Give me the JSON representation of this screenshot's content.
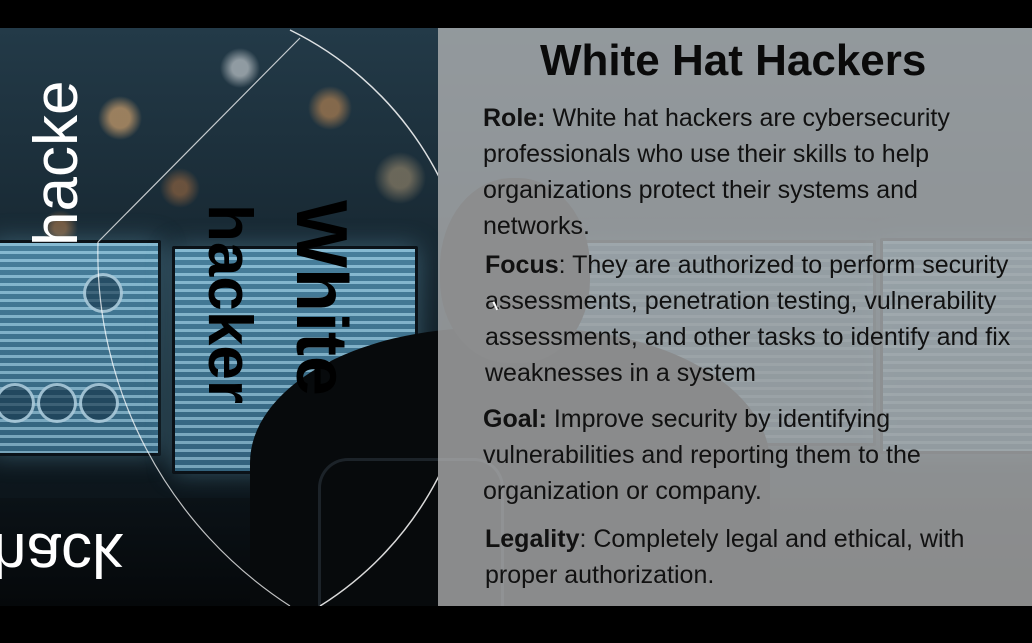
{
  "slide": {
    "title": "White Hat Hackers",
    "decor": {
      "hacker_top": "hacke",
      "white": "White",
      "hacker_mid": "hacker",
      "hacker_bottom": "hack"
    },
    "sections": {
      "role": {
        "label": "Role:",
        "text": " White hat hackers are cybersecurity professionals who use their skills to help organizations protect their systems and networks."
      },
      "focus": {
        "label": "Focus",
        "text": ": They are authorized to perform security assessments, penetration testing, vulnerability assessments, and other tasks to identify and fix weaknesses in a system"
      },
      "goal": {
        "label": "Goal:",
        "text": " Improve security by identifying vulnerabilities and reporting them to the organization or company."
      },
      "legality": {
        "label": "Legality",
        "text": ": Completely legal and ethical, with proper authorization."
      }
    }
  }
}
